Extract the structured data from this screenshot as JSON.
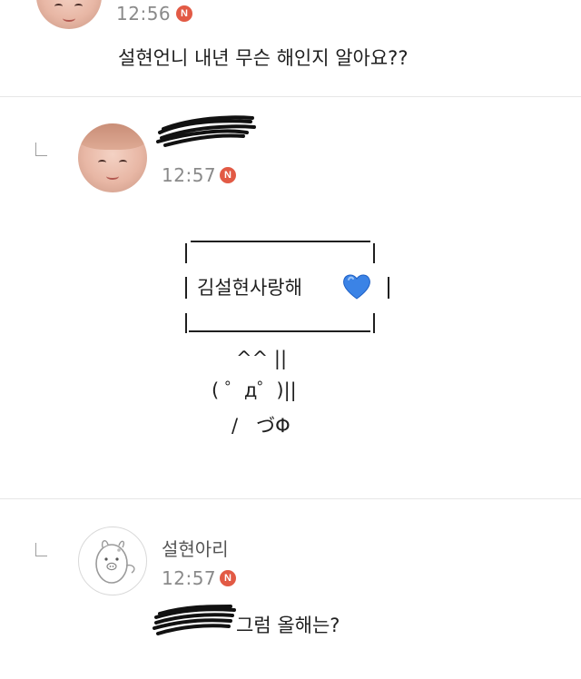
{
  "comments": [
    {
      "time": "12:56",
      "badge": "N",
      "text": "설현언니 내년 무슨 해인지 알아요??"
    },
    {
      "time": "12:57",
      "badge": "N",
      "box_text": "김설현사랑해",
      "heart": "blue-heart-icon",
      "art": {
        "line1": "^^ ||",
        "line2": "( ゜д゜)||",
        "line3": "/   づΦ"
      }
    },
    {
      "nickname": "설현아리",
      "time": "12:57",
      "badge": "N",
      "text": "그럼 올해는?"
    }
  ],
  "colors": {
    "badge": "#e25a45",
    "time": "#8a8a8a",
    "heart": "#3b83e6",
    "divider": "#e6e6e6"
  }
}
